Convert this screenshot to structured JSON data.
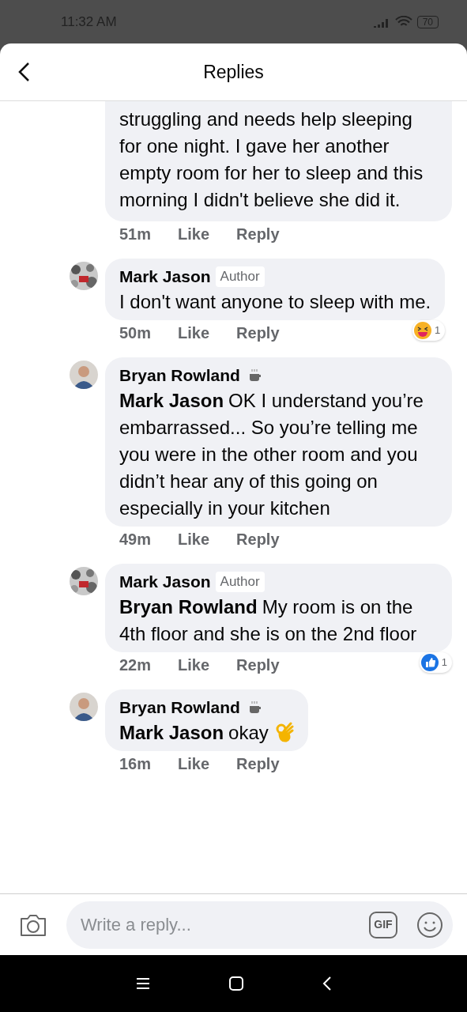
{
  "status_bar": {
    "time": "11:32 AM",
    "battery": "70"
  },
  "header": {
    "title": "Replies"
  },
  "comments": [
    {
      "text": "struggling and needs help sleeping for one night.  I gave her another empty room for her to sleep and this morning I didn't believe she did it.",
      "time": "51m",
      "actions": [
        "Like",
        "Reply"
      ],
      "cut_top": true
    },
    {
      "author": "Mark Jason",
      "badge": "Author",
      "text": "I don't want anyone to sleep with me.",
      "time": "50m",
      "actions": [
        "Like",
        "Reply"
      ],
      "reaction": {
        "kind": "haha",
        "count": "1"
      }
    },
    {
      "author": "Bryan Rowland",
      "coffee_mark": true,
      "mention": "Mark Jason",
      "text": "OK I understand you’re embarrassed... So you’re telling me you were in the other room and you didn’t hear any of this going on especially in your kitchen",
      "time": "49m",
      "actions": [
        "Like",
        "Reply"
      ]
    },
    {
      "author": "Mark Jason",
      "badge": "Author",
      "mention": "Bryan Rowland",
      "text": "My room is on the 4th floor and she is on the 2nd floor",
      "time": "22m",
      "actions": [
        "Like",
        "Reply"
      ],
      "reaction": {
        "kind": "like",
        "count": "1"
      }
    },
    {
      "author": "Bryan Rowland",
      "coffee_mark": true,
      "mention": "Mark Jason",
      "text": "okay",
      "ok_hand": true,
      "time": "16m",
      "actions": [
        "Like",
        "Reply"
      ]
    }
  ],
  "composer": {
    "placeholder": "Write a reply...",
    "gif_label": "GIF"
  }
}
